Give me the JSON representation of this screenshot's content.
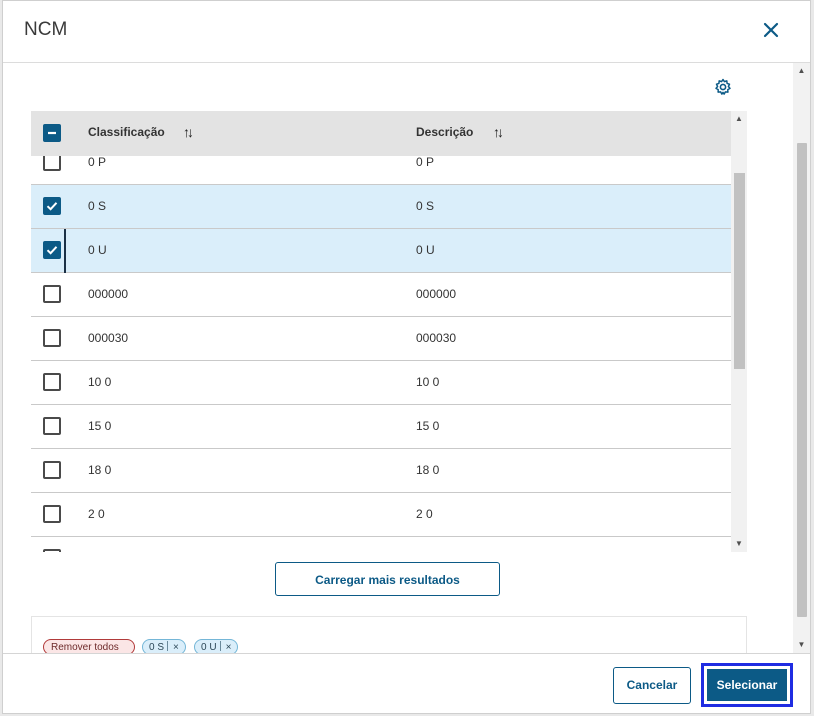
{
  "dialog": {
    "title": "NCM"
  },
  "table": {
    "headers": {
      "classificacao": "Classificação",
      "descricao": "Descrição"
    },
    "rows": [
      {
        "classificacao": "0 P",
        "descricao": "0 P",
        "selected": false
      },
      {
        "classificacao": "0 S",
        "descricao": "0 S",
        "selected": true
      },
      {
        "classificacao": "0 U",
        "descricao": "0 U",
        "selected": true
      },
      {
        "classificacao": "000000",
        "descricao": "000000",
        "selected": false
      },
      {
        "classificacao": "000030",
        "descricao": "000030",
        "selected": false
      },
      {
        "classificacao": "10 0",
        "descricao": "10 0",
        "selected": false
      },
      {
        "classificacao": "15 0",
        "descricao": "15 0",
        "selected": false
      },
      {
        "classificacao": "18 0",
        "descricao": "18 0",
        "selected": false
      },
      {
        "classificacao": "2 0",
        "descricao": "2 0",
        "selected": false
      }
    ]
  },
  "load_more_label": "Carregar mais resultados",
  "chips": {
    "remove_all": "Remover todos",
    "selected": [
      {
        "label": "0 S"
      },
      {
        "label": "0 U"
      }
    ]
  },
  "footer": {
    "cancel_label": "Cancelar",
    "select_label": "Selecionar"
  },
  "colors": {
    "primary": "#0c5a86",
    "selected_row": "#daeefa",
    "focus_outline": "#1f2ce2"
  }
}
